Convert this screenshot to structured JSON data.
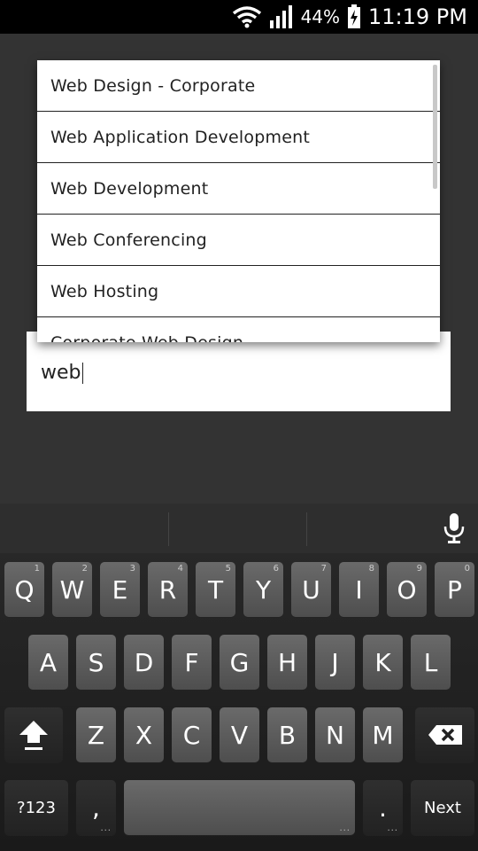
{
  "status_bar": {
    "battery_percent": "44%",
    "time": "11:19 PM",
    "icons": [
      "wifi-icon",
      "signal-icon",
      "battery-charging-icon"
    ]
  },
  "dropdown": {
    "items": [
      "Web Design - Corporate",
      "Web Application Development",
      "Web Development",
      "Web Conferencing",
      "Web Hosting",
      "Corporate Web Design"
    ]
  },
  "text_field": {
    "value": "web"
  },
  "keyboard": {
    "row1": [
      {
        "label": "Q",
        "hint": "1"
      },
      {
        "label": "W",
        "hint": "2"
      },
      {
        "label": "E",
        "hint": "3"
      },
      {
        "label": "R",
        "hint": "4"
      },
      {
        "label": "T",
        "hint": "5"
      },
      {
        "label": "Y",
        "hint": "6"
      },
      {
        "label": "U",
        "hint": "7"
      },
      {
        "label": "I",
        "hint": "8"
      },
      {
        "label": "O",
        "hint": "9"
      },
      {
        "label": "P",
        "hint": "0"
      }
    ],
    "row2": [
      "A",
      "S",
      "D",
      "F",
      "G",
      "H",
      "J",
      "K",
      "L"
    ],
    "row3": [
      "Z",
      "X",
      "C",
      "V",
      "B",
      "N",
      "M"
    ],
    "symbols_label": "?123",
    "comma_label": ",",
    "period_label": ".",
    "next_label": "Next",
    "icons": [
      "mic-icon",
      "shift-icon",
      "backspace-icon"
    ]
  },
  "colors": {
    "background": "#333333",
    "status_bar": "#000000",
    "key": "#5a5a5a",
    "key_dark": "#262626"
  }
}
